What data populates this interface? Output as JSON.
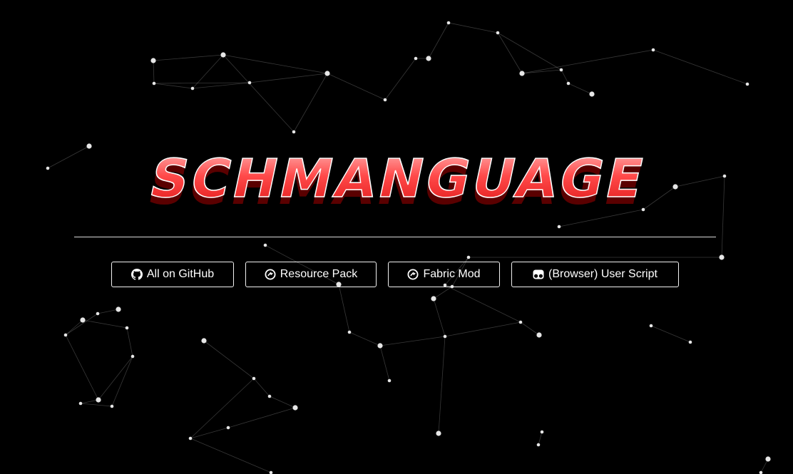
{
  "logo": {
    "text": "SCHMANGUAGE",
    "color": "#ff3b3b"
  },
  "buttons": [
    {
      "label": "All on GitHub",
      "icon": "github-icon"
    },
    {
      "label": "Resource Pack",
      "icon": "modrinth-icon"
    },
    {
      "label": "Fabric Mod",
      "icon": "modrinth-icon"
    },
    {
      "label": "(Browser) User Script",
      "icon": "tampermonkey-icon"
    }
  ],
  "colors": {
    "background": "#000000",
    "button_border": "#f2f2f2",
    "divider": "#d9d9d9",
    "logo_red": "#ff3b3b"
  }
}
